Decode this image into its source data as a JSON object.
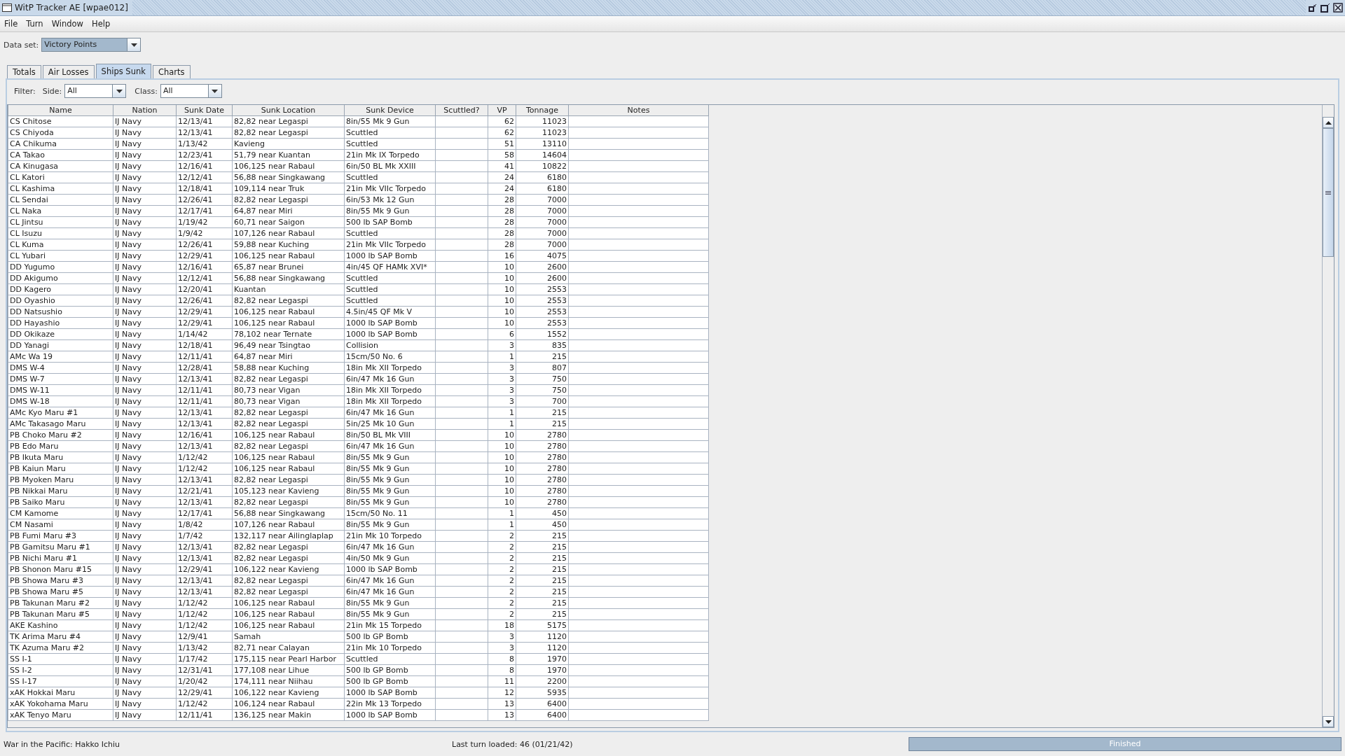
{
  "window": {
    "title": "WitP Tracker AE [wpae012]"
  },
  "menu": [
    "File",
    "Turn",
    "Window",
    "Help"
  ],
  "data_set": {
    "label": "Data set:",
    "value": "Victory Points"
  },
  "tabs": [
    {
      "label": "Totals",
      "selected": false
    },
    {
      "label": "Air Losses",
      "selected": false
    },
    {
      "label": "Ships Sunk",
      "selected": true
    },
    {
      "label": "Charts",
      "selected": false
    }
  ],
  "filter": {
    "label": "Filter:",
    "side": {
      "label": "Side:",
      "value": "All"
    },
    "class": {
      "label": "Class:",
      "value": "All"
    }
  },
  "table": {
    "columns": [
      "Name",
      "Nation",
      "Sunk Date",
      "Sunk Location",
      "Sunk Device",
      "Scuttled?",
      "VP",
      "Tonnage",
      "Notes"
    ],
    "rows": [
      {
        "name": "CS Chitose",
        "nation": "IJ Navy",
        "date": "12/13/41",
        "location": "82,82 near Legaspi",
        "device": "8in/55 Mk 9 Gun",
        "vp": "62",
        "tonnage": "11023"
      },
      {
        "name": "CS Chiyoda",
        "nation": "IJ Navy",
        "date": "12/13/41",
        "location": "82,82 near Legaspi",
        "device": "Scuttled",
        "vp": "62",
        "tonnage": "11023"
      },
      {
        "name": "CA Chikuma",
        "nation": "IJ Navy",
        "date": "1/13/42",
        "location": "Kavieng",
        "device": "Scuttled",
        "vp": "51",
        "tonnage": "13110"
      },
      {
        "name": "CA Takao",
        "nation": "IJ Navy",
        "date": "12/23/41",
        "location": "51,79 near Kuantan",
        "device": "21in Mk IX Torpedo",
        "vp": "58",
        "tonnage": "14604"
      },
      {
        "name": "CA Kinugasa",
        "nation": "IJ Navy",
        "date": "12/16/41",
        "location": "106,125 near Rabaul",
        "device": "6in/50 BL Mk XXIII",
        "vp": "41",
        "tonnage": "10822"
      },
      {
        "name": "CL Katori",
        "nation": "IJ Navy",
        "date": "12/12/41",
        "location": "56,88 near Singkawang",
        "device": "Scuttled",
        "vp": "24",
        "tonnage": "6180"
      },
      {
        "name": "CL Kashima",
        "nation": "IJ Navy",
        "date": "12/18/41",
        "location": "109,114 near Truk",
        "device": "21in Mk VIIc Torpedo",
        "vp": "24",
        "tonnage": "6180"
      },
      {
        "name": "CL Sendai",
        "nation": "IJ Navy",
        "date": "12/26/41",
        "location": "82,82 near Legaspi",
        "device": "6in/53 Mk 12 Gun",
        "vp": "28",
        "tonnage": "7000"
      },
      {
        "name": "CL Naka",
        "nation": "IJ Navy",
        "date": "12/17/41",
        "location": "64,87 near Miri",
        "device": "8in/55 Mk 9 Gun",
        "vp": "28",
        "tonnage": "7000"
      },
      {
        "name": "CL Jintsu",
        "nation": "IJ Navy",
        "date": "1/19/42",
        "location": "60,71 near Saigon",
        "device": "500 lb SAP Bomb",
        "vp": "28",
        "tonnage": "7000"
      },
      {
        "name": "CL Isuzu",
        "nation": "IJ Navy",
        "date": "1/9/42",
        "location": "107,126 near Rabaul",
        "device": "Scuttled",
        "vp": "28",
        "tonnage": "7000"
      },
      {
        "name": "CL Kuma",
        "nation": "IJ Navy",
        "date": "12/26/41",
        "location": "59,88 near Kuching",
        "device": "21in Mk VIIc Torpedo",
        "vp": "28",
        "tonnage": "7000"
      },
      {
        "name": "CL Yubari",
        "nation": "IJ Navy",
        "date": "12/29/41",
        "location": "106,125 near Rabaul",
        "device": "1000 lb SAP Bomb",
        "vp": "16",
        "tonnage": "4075"
      },
      {
        "name": "DD Yugumo",
        "nation": "IJ Navy",
        "date": "12/16/41",
        "location": "65,87 near Brunei",
        "device": "4in/45 QF HAMk XVI*",
        "vp": "10",
        "tonnage": "2600"
      },
      {
        "name": "DD Akigumo",
        "nation": "IJ Navy",
        "date": "12/12/41",
        "location": "56,88 near Singkawang",
        "device": "Scuttled",
        "vp": "10",
        "tonnage": "2600"
      },
      {
        "name": "DD Kagero",
        "nation": "IJ Navy",
        "date": "12/20/41",
        "location": "Kuantan",
        "device": "Scuttled",
        "vp": "10",
        "tonnage": "2553"
      },
      {
        "name": "DD Oyashio",
        "nation": "IJ Navy",
        "date": "12/26/41",
        "location": "82,82 near Legaspi",
        "device": "Scuttled",
        "vp": "10",
        "tonnage": "2553"
      },
      {
        "name": "DD Natsushio",
        "nation": "IJ Navy",
        "date": "12/29/41",
        "location": "106,125 near Rabaul",
        "device": "4.5in/45 QF Mk V",
        "vp": "10",
        "tonnage": "2553"
      },
      {
        "name": "DD Hayashio",
        "nation": "IJ Navy",
        "date": "12/29/41",
        "location": "106,125 near Rabaul",
        "device": "1000 lb SAP Bomb",
        "vp": "10",
        "tonnage": "2553"
      },
      {
        "name": "DD Okikaze",
        "nation": "IJ Navy",
        "date": "1/14/42",
        "location": "78,102 near Ternate",
        "device": "1000 lb SAP Bomb",
        "vp": "6",
        "tonnage": "1552"
      },
      {
        "name": "DD Yanagi",
        "nation": "IJ Navy",
        "date": "12/18/41",
        "location": "96,49 near Tsingtao",
        "device": "Collision",
        "vp": "3",
        "tonnage": "835"
      },
      {
        "name": "AMc Wa 19",
        "nation": "IJ Navy",
        "date": "12/11/41",
        "location": "64,87 near Miri",
        "device": "15cm/50 No. 6",
        "vp": "1",
        "tonnage": "215"
      },
      {
        "name": "DMS W-4",
        "nation": "IJ Navy",
        "date": "12/28/41",
        "location": "58,88 near Kuching",
        "device": "18in Mk XII Torpedo",
        "vp": "3",
        "tonnage": "807"
      },
      {
        "name": "DMS W-7",
        "nation": "IJ Navy",
        "date": "12/13/41",
        "location": "82,82 near Legaspi",
        "device": "6in/47 Mk 16 Gun",
        "vp": "3",
        "tonnage": "750"
      },
      {
        "name": "DMS W-11",
        "nation": "IJ Navy",
        "date": "12/11/41",
        "location": "80,73 near Vigan",
        "device": "18in Mk XII Torpedo",
        "vp": "3",
        "tonnage": "750"
      },
      {
        "name": "DMS W-18",
        "nation": "IJ Navy",
        "date": "12/11/41",
        "location": "80,73 near Vigan",
        "device": "18in Mk XII Torpedo",
        "vp": "3",
        "tonnage": "700"
      },
      {
        "name": "AMc Kyo Maru #1",
        "nation": "IJ Navy",
        "date": "12/13/41",
        "location": "82,82 near Legaspi",
        "device": "6in/47 Mk 16 Gun",
        "vp": "1",
        "tonnage": "215"
      },
      {
        "name": "AMc Takasago Maru",
        "nation": "IJ Navy",
        "date": "12/13/41",
        "location": "82,82 near Legaspi",
        "device": "5in/25 Mk 10 Gun",
        "vp": "1",
        "tonnage": "215"
      },
      {
        "name": "PB Choko Maru #2",
        "nation": "IJ Navy",
        "date": "12/16/41",
        "location": "106,125 near Rabaul",
        "device": "8in/50 BL Mk VIII",
        "vp": "10",
        "tonnage": "2780"
      },
      {
        "name": "PB Edo Maru",
        "nation": "IJ Navy",
        "date": "12/13/41",
        "location": "82,82 near Legaspi",
        "device": "6in/47 Mk 16 Gun",
        "vp": "10",
        "tonnage": "2780"
      },
      {
        "name": "PB Ikuta Maru",
        "nation": "IJ Navy",
        "date": "1/12/42",
        "location": "106,125 near Rabaul",
        "device": "8in/55 Mk 9 Gun",
        "vp": "10",
        "tonnage": "2780"
      },
      {
        "name": "PB Kaiun Maru",
        "nation": "IJ Navy",
        "date": "1/12/42",
        "location": "106,125 near Rabaul",
        "device": "8in/55 Mk 9 Gun",
        "vp": "10",
        "tonnage": "2780"
      },
      {
        "name": "PB Myoken Maru",
        "nation": "IJ Navy",
        "date": "12/13/41",
        "location": "82,82 near Legaspi",
        "device": "8in/55 Mk 9 Gun",
        "vp": "10",
        "tonnage": "2780"
      },
      {
        "name": "PB Nikkai Maru",
        "nation": "IJ Navy",
        "date": "12/21/41",
        "location": "105,123 near Kavieng",
        "device": "8in/55 Mk 9 Gun",
        "vp": "10",
        "tonnage": "2780"
      },
      {
        "name": "PB Saiko Maru",
        "nation": "IJ Navy",
        "date": "12/13/41",
        "location": "82,82 near Legaspi",
        "device": "8in/55 Mk 9 Gun",
        "vp": "10",
        "tonnage": "2780"
      },
      {
        "name": "CM Kamome",
        "nation": "IJ Navy",
        "date": "12/17/41",
        "location": "56,88 near Singkawang",
        "device": "15cm/50 No. 11",
        "vp": "1",
        "tonnage": "450"
      },
      {
        "name": "CM Nasami",
        "nation": "IJ Navy",
        "date": "1/8/42",
        "location": "107,126 near Rabaul",
        "device": "8in/55 Mk 9 Gun",
        "vp": "1",
        "tonnage": "450"
      },
      {
        "name": "PB Fumi Maru #3",
        "nation": "IJ Navy",
        "date": "1/7/42",
        "location": "132,117 near Ailinglaplap",
        "device": "21in Mk 10 Torpedo",
        "vp": "2",
        "tonnage": "215"
      },
      {
        "name": "PB Gamitsu Maru #1",
        "nation": "IJ Navy",
        "date": "12/13/41",
        "location": "82,82 near Legaspi",
        "device": "6in/47 Mk 16 Gun",
        "vp": "2",
        "tonnage": "215"
      },
      {
        "name": "PB Nichi Maru #1",
        "nation": "IJ Navy",
        "date": "12/13/41",
        "location": "82,82 near Legaspi",
        "device": "4in/50 Mk 9 Gun",
        "vp": "2",
        "tonnage": "215"
      },
      {
        "name": "PB Shonon Maru #15",
        "nation": "IJ Navy",
        "date": "12/29/41",
        "location": "106,122 near Kavieng",
        "device": "1000 lb SAP Bomb",
        "vp": "2",
        "tonnage": "215"
      },
      {
        "name": "PB Showa Maru #3",
        "nation": "IJ Navy",
        "date": "12/13/41",
        "location": "82,82 near Legaspi",
        "device": "6in/47 Mk 16 Gun",
        "vp": "2",
        "tonnage": "215"
      },
      {
        "name": "PB Showa Maru #5",
        "nation": "IJ Navy",
        "date": "12/13/41",
        "location": "82,82 near Legaspi",
        "device": "6in/47 Mk 16 Gun",
        "vp": "2",
        "tonnage": "215"
      },
      {
        "name": "PB Takunan Maru #2",
        "nation": "IJ Navy",
        "date": "1/12/42",
        "location": "106,125 near Rabaul",
        "device": "8in/55 Mk 9 Gun",
        "vp": "2",
        "tonnage": "215"
      },
      {
        "name": "PB Takunan Maru #5",
        "nation": "IJ Navy",
        "date": "1/12/42",
        "location": "106,125 near Rabaul",
        "device": "8in/55 Mk 9 Gun",
        "vp": "2",
        "tonnage": "215"
      },
      {
        "name": "AKE Kashino",
        "nation": "IJ Navy",
        "date": "1/12/42",
        "location": "106,125 near Rabaul",
        "device": "21in Mk 15 Torpedo",
        "vp": "18",
        "tonnage": "5175"
      },
      {
        "name": "TK Arima Maru #4",
        "nation": "IJ Navy",
        "date": "12/9/41",
        "location": "Samah",
        "device": "500 lb GP Bomb",
        "vp": "3",
        "tonnage": "1120"
      },
      {
        "name": "TK Azuma Maru #2",
        "nation": "IJ Navy",
        "date": "1/13/42",
        "location": "82,71 near Calayan",
        "device": "21in Mk 10 Torpedo",
        "vp": "3",
        "tonnage": "1120"
      },
      {
        "name": "SS I-1",
        "nation": "IJ Navy",
        "date": "1/17/42",
        "location": "175,115 near Pearl Harbor",
        "device": "Scuttled",
        "vp": "8",
        "tonnage": "1970"
      },
      {
        "name": "SS I-2",
        "nation": "IJ Navy",
        "date": "12/31/41",
        "location": "177,108 near Lihue",
        "device": "500 lb GP Bomb",
        "vp": "8",
        "tonnage": "1970"
      },
      {
        "name": "SS I-17",
        "nation": "IJ Navy",
        "date": "1/20/42",
        "location": "174,111 near Niihau",
        "device": "500 lb GP Bomb",
        "vp": "11",
        "tonnage": "2200"
      },
      {
        "name": "xAK Hokkai Maru",
        "nation": "IJ Navy",
        "date": "12/29/41",
        "location": "106,122 near Kavieng",
        "device": "1000 lb SAP Bomb",
        "vp": "12",
        "tonnage": "5935"
      },
      {
        "name": "xAK Yokohama Maru",
        "nation": "IJ Navy",
        "date": "1/12/42",
        "location": "106,124 near Rabaul",
        "device": "22in Mk 13 Torpedo",
        "vp": "13",
        "tonnage": "6400"
      },
      {
        "name": "xAK Tenyo Maru",
        "nation": "IJ Navy",
        "date": "12/11/41",
        "location": "136,125 near Makin",
        "device": "1000 lb SAP Bomb",
        "vp": "13",
        "tonnage": "6400"
      }
    ]
  },
  "status_bar": {
    "game": "War in the Pacific: Hakko Ichiu",
    "last_turn": "Last turn loaded: 46 (01/21/42)",
    "progress": {
      "text": "Finished",
      "level": 1
    }
  }
}
